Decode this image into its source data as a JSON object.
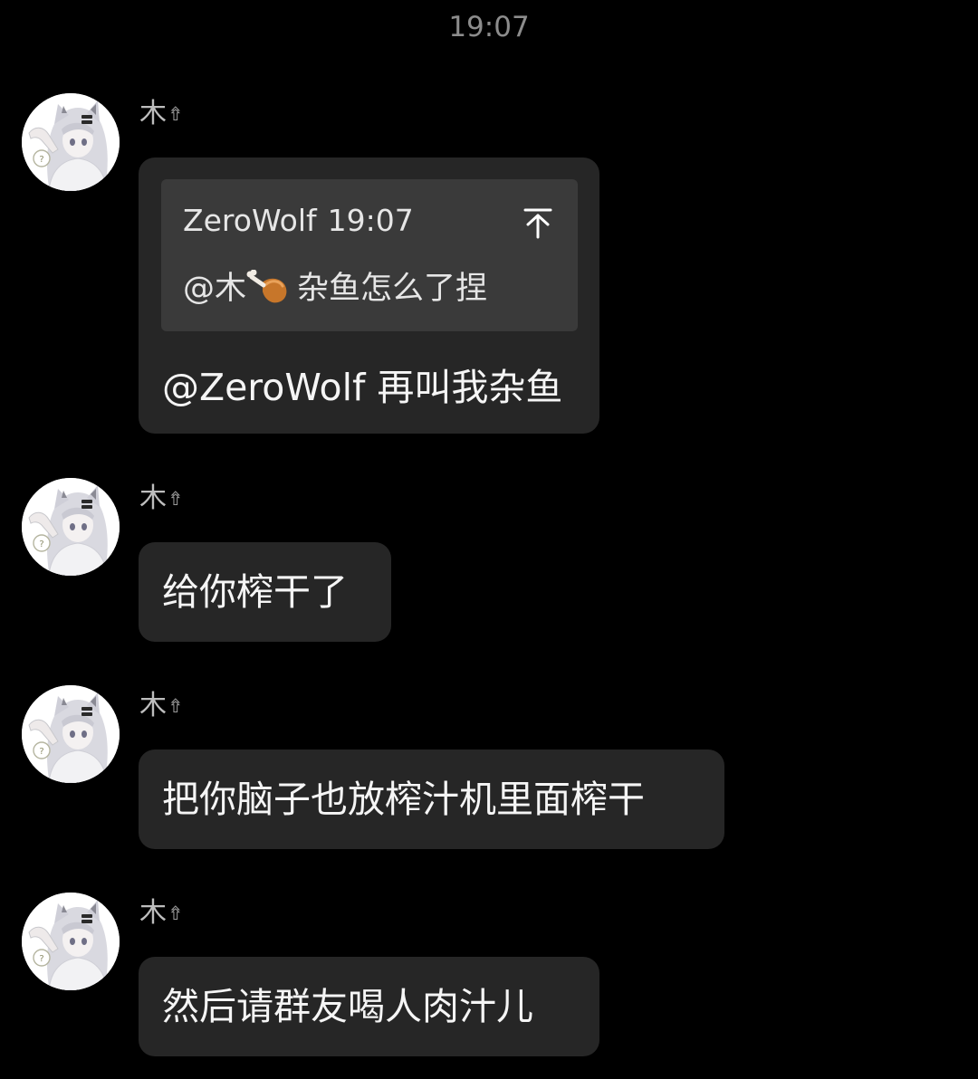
{
  "chat": {
    "time_divider": "19:07",
    "messages": [
      {
        "sender": "木",
        "sender_badge": "⇮",
        "quote": {
          "author": "ZeroWolf",
          "time": "19:07",
          "mention": "@木",
          "mention_icon": "drumstick-icon",
          "text": "杂鱼怎么了捏",
          "jump_icon": "jump-to-message-icon"
        },
        "text": "@ZeroWolf 再叫我杂鱼"
      },
      {
        "sender": "木",
        "sender_badge": "⇮",
        "text": "给你榨干了"
      },
      {
        "sender": "木",
        "sender_badge": "⇮",
        "text": "把你脑子也放榨汁机里面榨干"
      },
      {
        "sender": "木",
        "sender_badge": "⇮",
        "text": "然后请群友喝人肉汁儿"
      }
    ]
  },
  "colors": {
    "background": "#000000",
    "bubble": "#262626",
    "quote_box": "#3a3a3a",
    "timestamp": "#8c8c8c",
    "sender_name": "#bdbdbd"
  }
}
